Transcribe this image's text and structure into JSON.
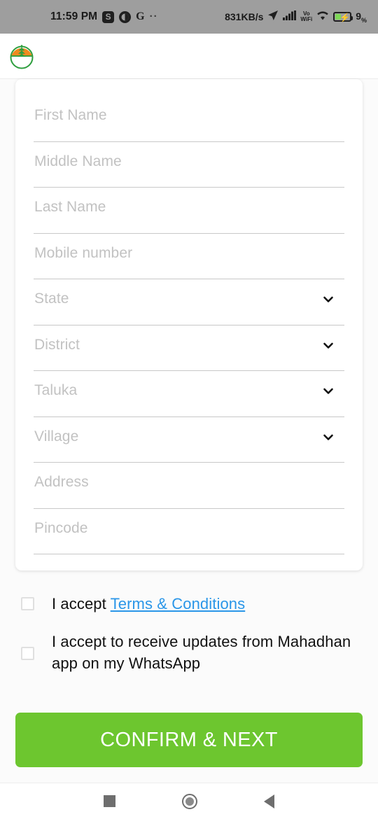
{
  "status_bar": {
    "time": "11:59 PM",
    "app_badge_s": "S",
    "app_badge_circle": "◕",
    "app_badge_g": "G",
    "overflow": "··",
    "network_speed": "831KB/s",
    "location_icon": "location-arrow-icon",
    "signal_icon": "signal-bars-icon",
    "vowifi_top": "Vo",
    "vowifi_bottom": "WiFi",
    "wifi_icon": "wifi-icon",
    "battery_percent": "9",
    "battery_percent_symbol": "%",
    "battery_charging": true,
    "background_color": "#9e9e9e"
  },
  "app_bar": {
    "logo_name": "mahadhan-logo",
    "logo_colors": {
      "ring": "#2e9e3e",
      "top": "#f08a1e",
      "plant": "#2e9e3e"
    }
  },
  "form": {
    "fields": [
      {
        "name": "first-name",
        "placeholder": "First Name",
        "value": "",
        "type": "text"
      },
      {
        "name": "middle-name",
        "placeholder": "Middle Name",
        "value": "",
        "type": "text"
      },
      {
        "name": "last-name",
        "placeholder": "Last Name",
        "value": "",
        "type": "text"
      },
      {
        "name": "mobile-number",
        "placeholder": "Mobile number",
        "value": "",
        "type": "tel"
      },
      {
        "name": "state",
        "placeholder": "State",
        "value": "",
        "type": "select"
      },
      {
        "name": "district",
        "placeholder": "District",
        "value": "",
        "type": "select"
      },
      {
        "name": "taluka",
        "placeholder": "Taluka",
        "value": "",
        "type": "select"
      },
      {
        "name": "village",
        "placeholder": "Village",
        "value": "",
        "type": "select"
      },
      {
        "name": "address",
        "placeholder": "Address",
        "value": "",
        "type": "text"
      },
      {
        "name": "pincode",
        "placeholder": "Pincode",
        "value": "",
        "type": "number"
      }
    ]
  },
  "consents": {
    "terms": {
      "prefix": "I accept ",
      "link_text": "Terms & Conditions",
      "checked": false,
      "link_color": "#2a96e8"
    },
    "whatsapp": {
      "text": "I accept to receive updates from Mahadhan app on my WhatsApp",
      "checked": false
    }
  },
  "primary_button": {
    "label": "CONFIRM & NEXT",
    "color": "#6dc62f",
    "text_color": "#ffffff"
  },
  "nav_bar": {
    "recents": "recents-square-icon",
    "home": "home-circle-icon",
    "back": "back-triangle-icon"
  }
}
